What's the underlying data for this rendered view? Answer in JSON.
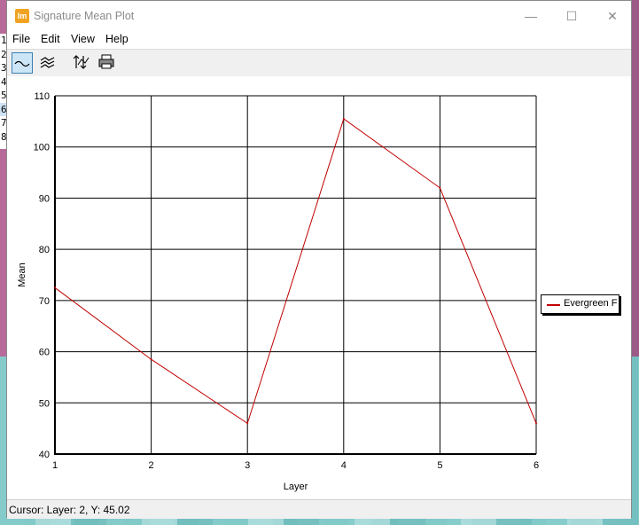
{
  "window": {
    "title": "Signature Mean Plot",
    "app_icon_text": "Im",
    "controls": {
      "minimize": "—",
      "maximize": "☐",
      "close": "✕"
    }
  },
  "left_grid": {
    "rows": [
      "1",
      "2",
      "3",
      "4",
      "5",
      "6",
      "7",
      "8"
    ]
  },
  "menu": {
    "items": [
      "File",
      "Edit",
      "View",
      "Help"
    ]
  },
  "toolbar": {
    "buttons": [
      {
        "icon": "line-plot-icon",
        "active": true
      },
      {
        "icon": "stacked-plot-icon",
        "active": false
      },
      {
        "icon": "axis-scale-icon",
        "active": false
      },
      {
        "icon": "print-icon",
        "active": false
      }
    ]
  },
  "chart_data": {
    "type": "line",
    "xlabel": "Layer",
    "ylabel": "Mean",
    "x": [
      1,
      2,
      3,
      4,
      5,
      6
    ],
    "xlim": [
      1,
      6
    ],
    "ylim": [
      40,
      110
    ],
    "xticks": [
      1,
      2,
      3,
      4,
      5,
      6
    ],
    "yticks": [
      40,
      50,
      60,
      70,
      80,
      90,
      100,
      110
    ],
    "grid": true,
    "legend_position": "right",
    "series": [
      {
        "name": "Evergreen Fo",
        "color": "#c00000",
        "values": [
          72.5,
          58.5,
          46,
          105.5,
          92,
          46
        ]
      }
    ]
  },
  "status": {
    "text": "Cursor: Layer: 2, Y: 45.02"
  }
}
